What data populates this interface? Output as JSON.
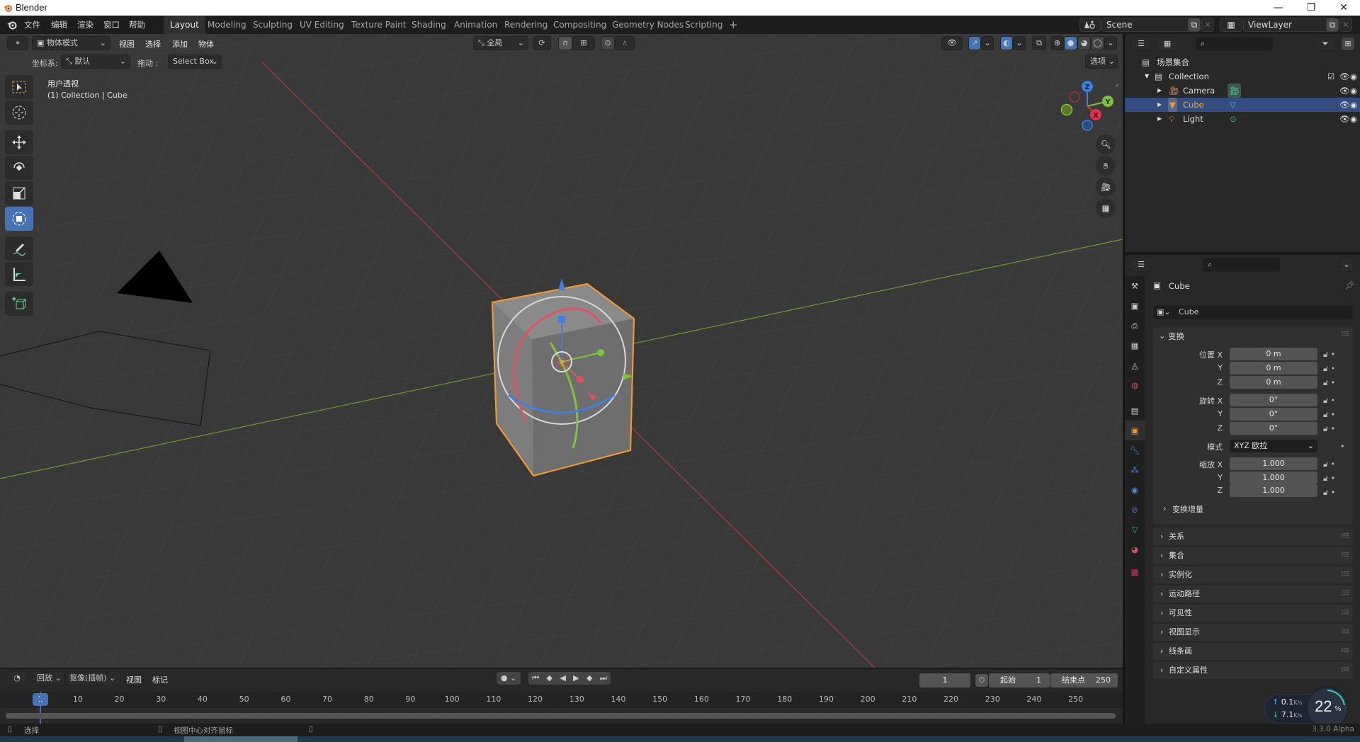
{
  "window": {
    "title": "Blender",
    "minimize": "—",
    "maximize": "❐",
    "close": "✕"
  },
  "menu": {
    "items": [
      "文件",
      "编辑",
      "渲染",
      "窗口",
      "帮助"
    ]
  },
  "workspaces": {
    "tabs": [
      "Layout",
      "Modeling",
      "Sculpting",
      "UV Editing",
      "Texture Paint",
      "Shading",
      "Animation",
      "Rendering",
      "Compositing",
      "Geometry Nodes",
      "Scripting"
    ],
    "active": "Layout",
    "add_label": "+"
  },
  "scene": {
    "name": "Scene",
    "view_layer": "ViewLayer"
  },
  "viewport": {
    "header": {
      "mode": "物体模式",
      "menus": [
        "视图",
        "选择",
        "添加",
        "物体"
      ],
      "transform_orientation": "全局",
      "options_label": "选项"
    },
    "tool_settings": {
      "coord_label": "坐标系:",
      "coord_value": "默认",
      "drag_label": "拖动 :",
      "drag_value": "Select Box"
    },
    "overlay_text": {
      "view_name": "用户透视",
      "context": "(1) Collection | Cube"
    },
    "nav_gizmo": {
      "x": "X",
      "y": "Y",
      "z": "Z"
    },
    "tools": [
      "select-box",
      "cursor",
      "move",
      "rotate",
      "scale",
      "transform",
      "annotate",
      "measure",
      "add-cube"
    ],
    "active_tool": "transform"
  },
  "outliner": {
    "root": "场景集合",
    "collection": "Collection",
    "items": [
      {
        "name": "Camera",
        "type": "camera",
        "selected": false
      },
      {
        "name": "Cube",
        "type": "mesh",
        "selected": true
      },
      {
        "name": "Light",
        "type": "light",
        "selected": false
      }
    ]
  },
  "properties": {
    "object_name": "Cube",
    "datablock_name": "Cube",
    "transform": {
      "header": "变换",
      "location_label": "位置 X",
      "location": [
        "0 m",
        "0 m",
        "0 m"
      ],
      "rotation_label": "旋转 X",
      "rotation": [
        "0°",
        "0°",
        "0°"
      ],
      "mode_label": "模式",
      "mode_value": "XYZ 欧拉",
      "scale_label": "缩放 X",
      "scale": [
        "1.000",
        "1.000",
        "1.000"
      ],
      "axis_y": "Y",
      "axis_z": "Z",
      "delta": "变换增量"
    },
    "panels": [
      "关系",
      "集合",
      "实例化",
      "运动路径",
      "可见性",
      "视图显示",
      "线条画",
      "自定义属性"
    ]
  },
  "timeline": {
    "menus": [
      "回放",
      "抠像(插帧)",
      "视图",
      "标记"
    ],
    "current_frame": "1",
    "start_label": "起始",
    "start": "1",
    "end_label": "结束点",
    "end": "250",
    "ruler": [
      "10",
      "20",
      "30",
      "40",
      "50",
      "60",
      "70",
      "80",
      "90",
      "100",
      "110",
      "120",
      "130",
      "140",
      "150",
      "160",
      "170",
      "180",
      "190",
      "200",
      "210",
      "220",
      "230",
      "240",
      "250"
    ]
  },
  "statusbar": {
    "left_hint": "选择",
    "middle_hint": "视图中心对齐鼠标",
    "version": "3.3.0 Alpha"
  },
  "net_widget": {
    "up": "0.1",
    "down": "7.1",
    "unit": "K/s",
    "percent": "22",
    "percent_sign": "%"
  }
}
